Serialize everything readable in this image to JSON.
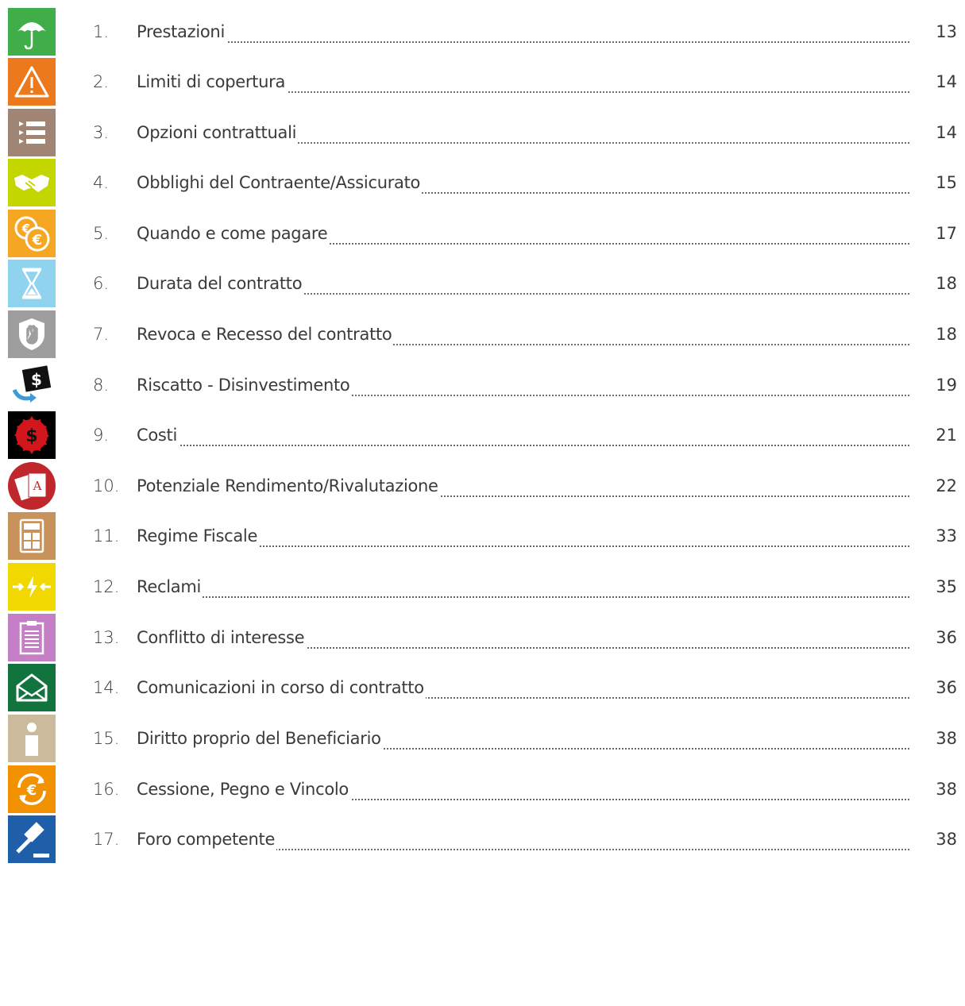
{
  "entries": [
    {
      "number": "1.",
      "title": "Prestazioni",
      "page": "13",
      "icon": "umbrella-icon",
      "color": "#3fae49"
    },
    {
      "number": "2.",
      "title": "Limiti di copertura",
      "page": "14",
      "icon": "warning-icon",
      "color": "#ec7a1c"
    },
    {
      "number": "3.",
      "title": "Opzioni contrattuali",
      "page": "14",
      "icon": "list-icon",
      "color": "#a08574"
    },
    {
      "number": "4.",
      "title": "Obblighi del Contraente/Assicurato",
      "page": "15",
      "icon": "handshake-icon",
      "color": "#c4d600"
    },
    {
      "number": "5.",
      "title": "Quando e come pagare",
      "page": "17",
      "icon": "euro-coins-icon",
      "color": "#f5a623"
    },
    {
      "number": "6.",
      "title": "Durata del contratto",
      "page": "18",
      "icon": "hourglass-icon",
      "color": "#8fd3ef"
    },
    {
      "number": "7.",
      "title": "Revoca e Recesso del contratto",
      "page": "18",
      "icon": "hand-shield-icon",
      "color": "#9e9e9e"
    },
    {
      "number": "8.",
      "title": "Riscatto - Disinvestimento",
      "page": "19",
      "icon": "money-transfer-icon",
      "color": "#3a9bd8"
    },
    {
      "number": "9.",
      "title": "Costi",
      "page": "21",
      "icon": "dollar-badge-icon",
      "color": "#000000"
    },
    {
      "number": "10.",
      "title": "Potenziale Rendimento/Rivalutazione",
      "page": "22",
      "icon": "playing-cards-icon",
      "color": "#c0272d"
    },
    {
      "number": "11.",
      "title": "Regime Fiscale",
      "page": "33",
      "icon": "calculator-icon",
      "color": "#c8935a"
    },
    {
      "number": "12.",
      "title": "Reclami",
      "page": "35",
      "icon": "conflict-arrows-icon",
      "color": "#f0d800"
    },
    {
      "number": "13.",
      "title": "Conflitto di interesse",
      "page": "36",
      "icon": "clipboard-icon",
      "color": "#c47fc6"
    },
    {
      "number": "14.",
      "title": "Comunicazioni in corso di contratto",
      "page": "36",
      "icon": "envelope-icon",
      "color": "#12733f"
    },
    {
      "number": "15.",
      "title": "Diritto proprio del Beneficiario",
      "page": "38",
      "icon": "person-icon",
      "color": "#cbbb9c"
    },
    {
      "number": "16.",
      "title": "Cessione, Pegno e Vincolo",
      "page": "38",
      "icon": "euro-exchange-icon",
      "color": "#f39200"
    },
    {
      "number": "17.",
      "title": "Foro competente",
      "page": "38",
      "icon": "gavel-icon",
      "color": "#1f5ea8"
    }
  ]
}
